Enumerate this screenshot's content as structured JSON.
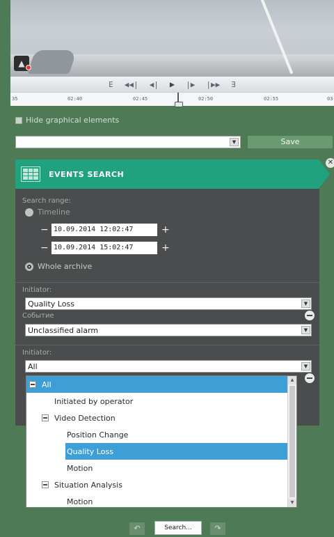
{
  "playback": {
    "controls": [
      "E",
      "◀◀|",
      "◀|",
      "▶",
      "|▶",
      "|▶▶",
      "∃"
    ],
    "ticks": [
      "35",
      "02:40",
      "02:45",
      "02:50",
      "02:55",
      "03"
    ]
  },
  "options": {
    "hide_graphics_label": "Hide graphical elements"
  },
  "preset": {
    "value": "",
    "save_label": "Save"
  },
  "panel": {
    "title": "EVENTS SEARCH",
    "search_range_label": "Search range:",
    "timeline_label": "Timeline",
    "start_datetime": "10.09.2014 12:02:47",
    "end_datetime": "10.09.2014 15:02:47",
    "whole_archive_label": "Whole archive",
    "filter1": {
      "initiator_label": "Initiator:",
      "initiator_value": "Quality Loss",
      "event_label": "Событие",
      "event_value": "Unclassified alarm"
    },
    "filter2": {
      "initiator_label": "Initiator:",
      "initiator_value": "All"
    }
  },
  "dropdown": {
    "items": [
      {
        "label": "All",
        "level": 0,
        "toggle": true,
        "selected": true
      },
      {
        "label": "Initiated by operator",
        "level": 1,
        "toggle": false,
        "selected": false
      },
      {
        "label": "Video Detection",
        "level": 1,
        "toggle": true,
        "selected": false
      },
      {
        "label": "Position Change",
        "level": 2,
        "toggle": false,
        "selected": false
      },
      {
        "label": "Quality Loss",
        "level": 2,
        "toggle": false,
        "selected": true
      },
      {
        "label": "Motion",
        "level": 2,
        "toggle": false,
        "selected": false
      },
      {
        "label": "Situation Analysis",
        "level": 1,
        "toggle": true,
        "selected": false
      },
      {
        "label": "Motion",
        "level": 2,
        "toggle": false,
        "selected": false
      }
    ]
  },
  "bottom": {
    "search_label": "Search...",
    "prev_icon": "↶",
    "next_icon": "↷"
  }
}
